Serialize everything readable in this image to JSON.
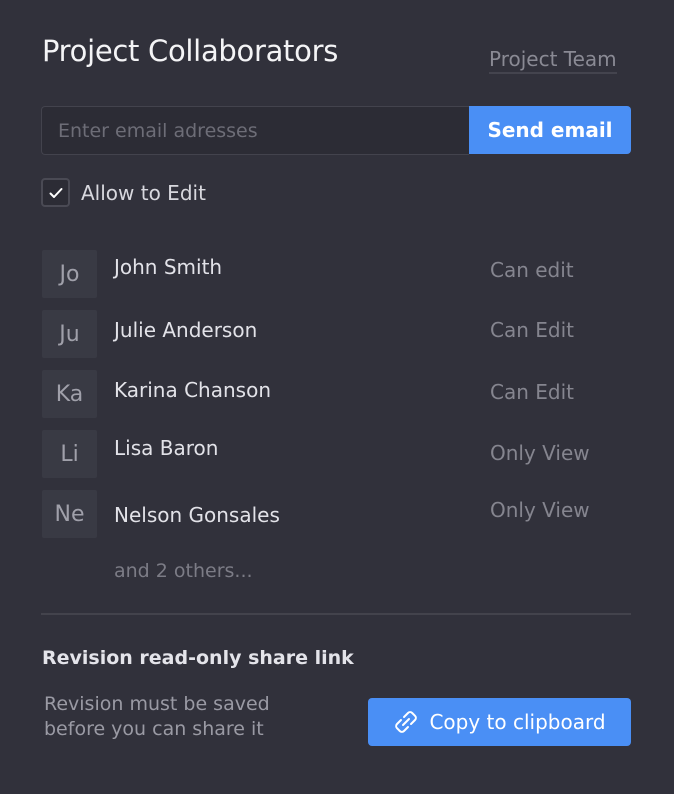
{
  "header": {
    "title": "Project Collaborators",
    "team_link": "Project Team"
  },
  "invite": {
    "email_placeholder": "Enter email adresses",
    "email_value": "",
    "send_label": "Send email",
    "allow_edit_label": "Allow to Edit",
    "allow_edit_checked": true
  },
  "collaborators": [
    {
      "initials": "Jo",
      "name": "John Smith",
      "permission": "Can edit"
    },
    {
      "initials": "Ju",
      "name": "Julie Anderson",
      "permission": "Can Edit"
    },
    {
      "initials": "Ka",
      "name": "Karina Chanson",
      "permission": "Can Edit"
    },
    {
      "initials": "Li",
      "name": "Lisa Baron",
      "permission": "Only View"
    },
    {
      "initials": "Ne",
      "name": "Nelson Gonsales",
      "permission": "Only View"
    }
  ],
  "others_label": "and 2 others...",
  "share": {
    "title": "Revision read-only share link",
    "description": "Revision must be saved before you can share it",
    "copy_label": "Copy to clipboard",
    "copy_icon": "link-icon"
  },
  "colors": {
    "background": "#31313b",
    "accent": "#4a8ff5",
    "avatar_bg": "#393a44"
  }
}
